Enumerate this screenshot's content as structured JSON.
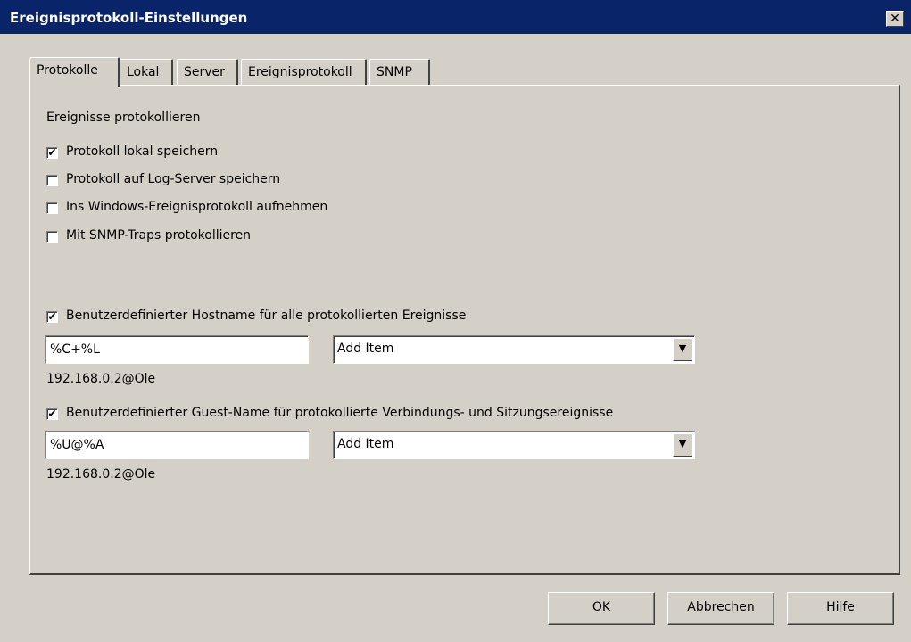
{
  "window": {
    "title": "Ereignisprotokoll-Einstellungen",
    "close_icon": "close-icon"
  },
  "tabs": [
    {
      "label": "Protokolle",
      "active": true
    },
    {
      "label": "Lokal",
      "active": false
    },
    {
      "label": "Server",
      "active": false
    },
    {
      "label": "Ereignisprotokoll",
      "active": false
    },
    {
      "label": "SNMP",
      "active": false
    }
  ],
  "section": {
    "heading": "Ereignisse protokollieren"
  },
  "checkboxes": [
    {
      "label": "Protokoll lokal speichern",
      "checked": true
    },
    {
      "label": "Protokoll auf Log-Server speichern",
      "checked": false
    },
    {
      "label": "Ins Windows-Ereignisprotokoll aufnehmen",
      "checked": false
    },
    {
      "label": "Mit SNMP-Traps protokollieren",
      "checked": false
    }
  ],
  "hostname": {
    "checkbox_label": "Benutzerdefinierter Hostname für alle protokollierten Ereignisse",
    "checked": true,
    "input_value": "%C+%L",
    "select_value": "Add Item",
    "preview": "192.168.0.2@Ole"
  },
  "guestname": {
    "checkbox_label": "Benutzerdefinierter Guest-Name für protokollierte Verbindungs- und Sitzungsereignisse",
    "checked": true,
    "input_value": "%U@%A",
    "select_value": "Add Item",
    "preview": "192.168.0.2@Ole"
  },
  "buttons": {
    "ok": "OK",
    "cancel": "Abbrechen",
    "help": "Hilfe"
  },
  "glyphs": {
    "check": "✔",
    "close": "✕",
    "dropdown": "▼"
  }
}
